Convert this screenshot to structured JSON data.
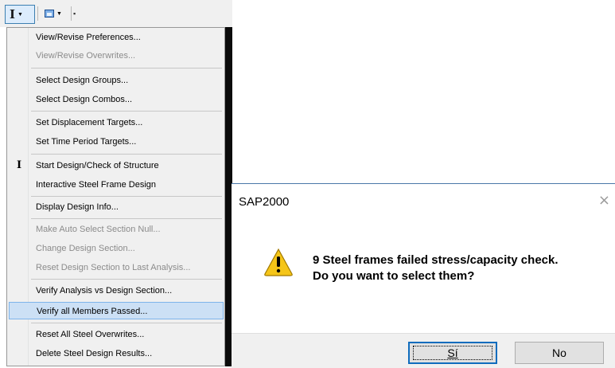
{
  "toolbar": {
    "steel_design_icon": "steel-i-beam-icon",
    "display_icon": "window-icon",
    "dropdown_glyph": "▼",
    "overflow_glyph": "▪"
  },
  "menu": {
    "items": [
      {
        "label": "View/Revise Preferences...",
        "enabled": true
      },
      {
        "label": "View/Revise Overwrites...",
        "enabled": false
      },
      {
        "label": "Select Design Groups...",
        "enabled": true
      },
      {
        "label": "Select Design Combos...",
        "enabled": true
      },
      {
        "label": "Set Displacement Targets...",
        "enabled": true
      },
      {
        "label": "Set Time Period Targets...",
        "enabled": true
      },
      {
        "label": "Start Design/Check of Structure",
        "enabled": true,
        "icon": "I"
      },
      {
        "label": "Interactive Steel Frame Design",
        "enabled": true
      },
      {
        "label": "Display Design Info...",
        "enabled": true
      },
      {
        "label": "Make Auto Select Section Null...",
        "enabled": false
      },
      {
        "label": "Change Design Section...",
        "enabled": false
      },
      {
        "label": "Reset Design Section to Last Analysis...",
        "enabled": false
      },
      {
        "label": "Verify Analysis vs Design Section...",
        "enabled": true
      },
      {
        "label": "Verify all Members Passed...",
        "enabled": true,
        "highlighted": true
      },
      {
        "label": "Reset All Steel Overwrites...",
        "enabled": true
      },
      {
        "label": "Delete Steel Design Results...",
        "enabled": true
      }
    ]
  },
  "dialog": {
    "title": "SAP2000",
    "close_glyph": "×",
    "message_line1": "9 Steel frames failed stress/capacity check.",
    "message_line2": "Do you want to select them?",
    "icon": "warning-icon",
    "yes_label": "Sí",
    "no_label": "No"
  },
  "colors": {
    "menu_bg": "#f0f0f0",
    "highlight": "#cce0f5",
    "highlight_border": "#7eb4ea",
    "dialog_bg": "#ffffff",
    "warning": "#f5c518"
  }
}
